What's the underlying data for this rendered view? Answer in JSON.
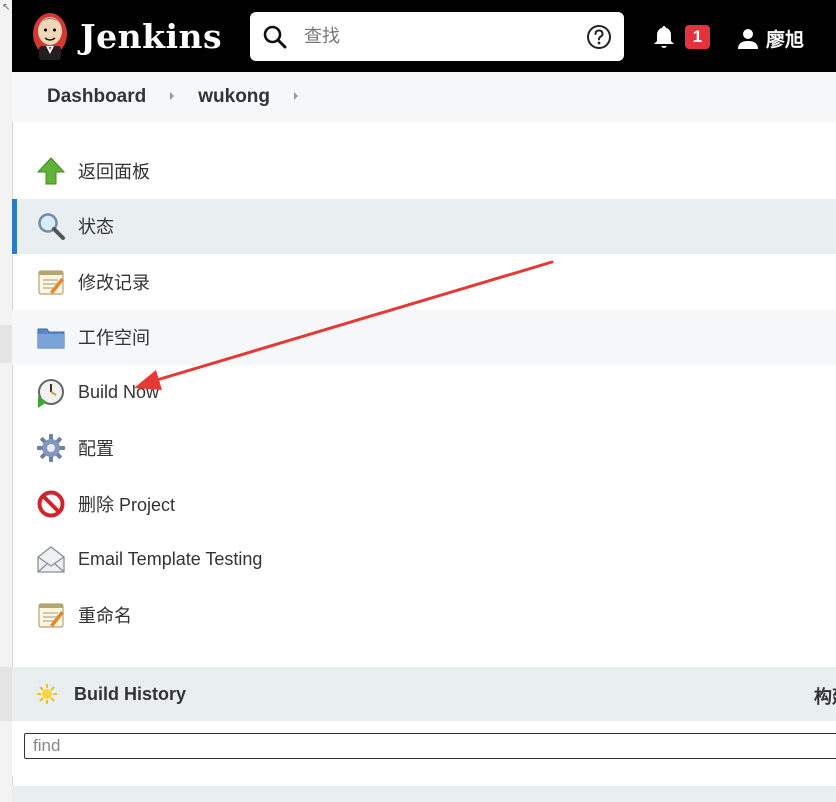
{
  "header": {
    "brand": "Jenkins",
    "search_placeholder": "查找",
    "notification_count": "1",
    "user_name": "廖旭"
  },
  "breadcrumb": {
    "items": [
      "Dashboard",
      "wukong"
    ]
  },
  "tasks": [
    {
      "label": "返回面板",
      "icon": "arrow-up-icon"
    },
    {
      "label": "状态",
      "icon": "magnifier-icon"
    },
    {
      "label": "修改记录",
      "icon": "notepad-icon"
    },
    {
      "label": "工作空间",
      "icon": "folder-icon"
    },
    {
      "label": "Build Now",
      "icon": "clock-play-icon"
    },
    {
      "label": "配置",
      "icon": "gear-icon"
    },
    {
      "label": "删除 Project",
      "icon": "no-entry-icon"
    },
    {
      "label": "Email Template Testing",
      "icon": "envelope-icon"
    },
    {
      "label": "重命名",
      "icon": "notepad-icon"
    }
  ],
  "build_history": {
    "title": "Build History",
    "trend_label": "构建",
    "find_placeholder": "find"
  },
  "colors": {
    "header_bg": "#000000",
    "active_accent": "#2f7bc0",
    "badge": "#e4333e",
    "annotation_arrow": "#e53935"
  }
}
